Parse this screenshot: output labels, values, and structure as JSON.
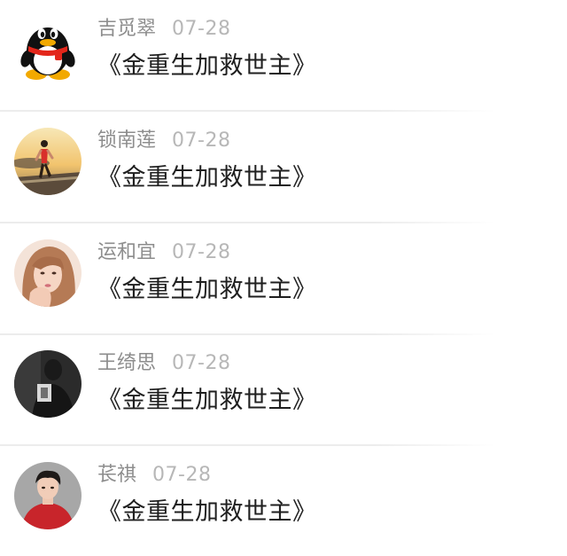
{
  "comments": [
    {
      "name": "吉觅翠",
      "date": "07-28",
      "text": "《金重生加救世主》",
      "avatar": "qq-penguin-icon"
    },
    {
      "name": "锁南莲",
      "date": "07-28",
      "text": "《金重生加救世主》",
      "avatar": "runner-photo"
    },
    {
      "name": "运和宜",
      "date": "07-28",
      "text": "《金重生加救世主》",
      "avatar": "girl-selfie-photo"
    },
    {
      "name": "王绮思",
      "date": "07-28",
      "text": "《金重生加救世主》",
      "avatar": "dark-portrait-photo"
    },
    {
      "name": "苌祺",
      "date": "07-28",
      "text": "《金重生加救世主》",
      "avatar": "boy-red-sweater-photo"
    }
  ]
}
